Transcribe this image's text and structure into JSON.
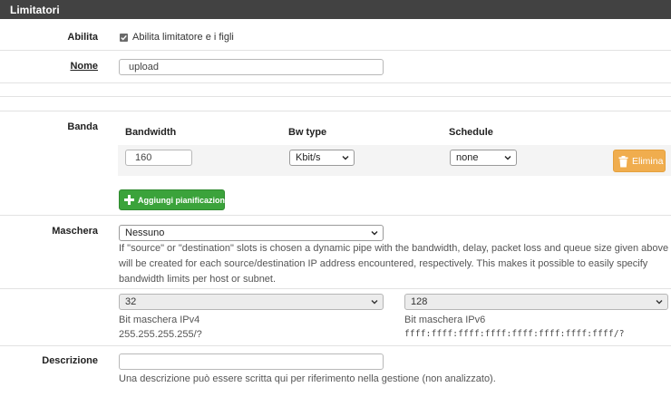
{
  "panel": {
    "title": "Limitatori"
  },
  "enable": {
    "label": "Abilita",
    "checkbox_label": "Abilita limitatore e i figli",
    "checked": true
  },
  "name": {
    "label": "Nome",
    "value": "upload"
  },
  "bandwidth": {
    "label": "Banda",
    "columns": [
      "Bandwidth",
      "Bw type",
      "Schedule"
    ],
    "value": "160",
    "bw_type": "Kbit/s",
    "schedule": "none",
    "delete_label": "Elimina",
    "add_label": "Aggiungi pianificazione"
  },
  "mask": {
    "label": "Maschera",
    "selected": "Nessuno",
    "help": "If \"source\" or \"destination\" slots is chosen a dynamic pipe with the bandwidth, delay, packet loss and queue size given above will be created for each source/destination IP address encountered, respectively. This makes it possible to easily specify bandwidth limits per host or subnet.",
    "ipv4_bits": "32",
    "ipv4_caption": "Bit maschera IPv4",
    "ipv4_mask": "255.255.255.255/?",
    "ipv6_bits": "128",
    "ipv6_caption": "Bit maschera IPv6",
    "ipv6_mask": "ffff:ffff:ffff:ffff:ffff:ffff:ffff:ffff/?"
  },
  "description": {
    "label": "Descrizione",
    "value": "",
    "help": "Una descrizione può essere scritta qui per riferimento nella gestione (non analizzato)."
  }
}
